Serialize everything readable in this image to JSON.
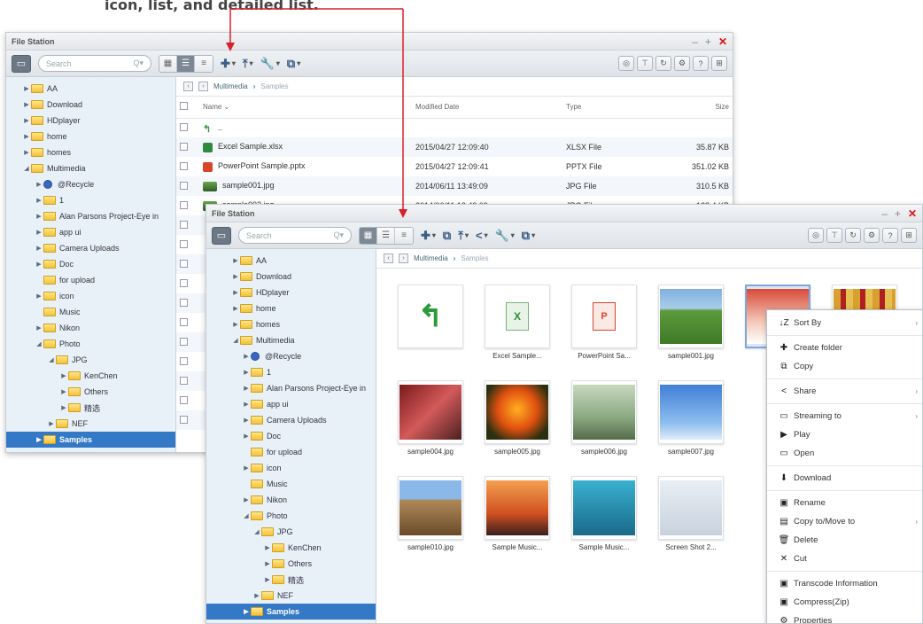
{
  "caption": "icon, list, and detailed list.",
  "colors": {
    "arrow": "#d9202a",
    "selection": "#3479c6",
    "sidebar_bg": "#e8f0f8"
  },
  "back_window": {
    "title": "File Station",
    "search_placeholder": "Search",
    "breadcrumb": [
      "Multimedia",
      "Samples"
    ],
    "tree": [
      {
        "label": "AA",
        "level": 1,
        "arrow": "▶",
        "icon": "folder-icon"
      },
      {
        "label": "Download",
        "level": 1,
        "arrow": "▶",
        "icon": "folder-icon"
      },
      {
        "label": "HDplayer",
        "level": 1,
        "arrow": "▶",
        "icon": "folder-icon"
      },
      {
        "label": "home",
        "level": 1,
        "arrow": "▶",
        "icon": "folder-icon"
      },
      {
        "label": "homes",
        "level": 1,
        "arrow": "▶",
        "icon": "folder-icon"
      },
      {
        "label": "Multimedia",
        "level": 1,
        "arrow": "◢",
        "icon": "folder-open-icon"
      },
      {
        "label": "@Recycle",
        "level": 2,
        "arrow": "▶",
        "icon": "recycle-icon"
      },
      {
        "label": "1",
        "level": 2,
        "arrow": "▶",
        "icon": "folder-icon"
      },
      {
        "label": "Alan Parsons Project-Eye in",
        "level": 2,
        "arrow": "▶",
        "icon": "folder-icon"
      },
      {
        "label": "app ui",
        "level": 2,
        "arrow": "▶",
        "icon": "folder-icon"
      },
      {
        "label": "Camera Uploads",
        "level": 2,
        "arrow": "▶",
        "icon": "folder-icon"
      },
      {
        "label": "Doc",
        "level": 2,
        "arrow": "▶",
        "icon": "folder-icon"
      },
      {
        "label": "for upload",
        "level": 2,
        "arrow": "",
        "icon": "folder-icon"
      },
      {
        "label": "icon",
        "level": 2,
        "arrow": "▶",
        "icon": "folder-icon"
      },
      {
        "label": "Music",
        "level": 2,
        "arrow": "",
        "icon": "folder-icon"
      },
      {
        "label": "Nikon",
        "level": 2,
        "arrow": "▶",
        "icon": "folder-icon"
      },
      {
        "label": "Photo",
        "level": 2,
        "arrow": "◢",
        "icon": "folder-open-icon"
      },
      {
        "label": "JPG",
        "level": 3,
        "arrow": "◢",
        "icon": "folder-open-icon"
      },
      {
        "label": "KenChen",
        "level": 4,
        "arrow": "▶",
        "icon": "folder-icon"
      },
      {
        "label": "Others",
        "level": 4,
        "arrow": "▶",
        "icon": "folder-icon"
      },
      {
        "label": "精选",
        "level": 4,
        "arrow": "▶",
        "icon": "folder-icon"
      },
      {
        "label": "NEF",
        "level": 3,
        "arrow": "▶",
        "icon": "folder-icon"
      },
      {
        "label": "Samples",
        "level": 2,
        "arrow": "▶",
        "icon": "folder-icon",
        "selected": true
      }
    ],
    "columns": [
      "Name ⌄",
      "Modified Date",
      "Type",
      "Size"
    ],
    "rows": [
      {
        "name": "..",
        "date": "",
        "type": "",
        "size": "",
        "icon": "up"
      },
      {
        "name": "Excel Sample.xlsx",
        "date": "2015/04/27 12:09:40",
        "type": "XLSX File",
        "size": "35.87 KB",
        "icon": "xls"
      },
      {
        "name": "PowerPoint Sample.pptx",
        "date": "2015/04/27 12:09:41",
        "type": "PPTX File",
        "size": "351.02 KB",
        "icon": "ppt"
      },
      {
        "name": "sample001.jpg",
        "date": "2014/06/11 13:49:09",
        "type": "JPG File",
        "size": "310.5 KB",
        "icon": "jpg"
      },
      {
        "name": "sample002.jpg",
        "date": "2014/06/11 13:49:09",
        "type": "JPG File",
        "size": "128.4 KB",
        "icon": "jpg"
      }
    ],
    "empty_rows": 11
  },
  "front_window": {
    "title": "File Station",
    "search_placeholder": "Search",
    "breadcrumb": [
      "Multimedia",
      "Samples"
    ],
    "tree": [
      {
        "label": "AA",
        "arrow": "▶"
      },
      {
        "label": "Download",
        "arrow": "▶"
      },
      {
        "label": "HDplayer",
        "arrow": "▶"
      },
      {
        "label": "home",
        "arrow": "▶"
      },
      {
        "label": "homes",
        "arrow": "▶"
      },
      {
        "label": "Multimedia",
        "arrow": "◢"
      },
      {
        "label": "@Recycle",
        "arrow": "▶",
        "icon": "recycle"
      },
      {
        "label": "1",
        "arrow": "▶"
      },
      {
        "label": "Alan Parsons Project-Eye in",
        "arrow": "▶"
      },
      {
        "label": "app ui",
        "arrow": "▶"
      },
      {
        "label": "Camera Uploads",
        "arrow": "▶"
      },
      {
        "label": "Doc",
        "arrow": "▶"
      },
      {
        "label": "for upload",
        "arrow": ""
      },
      {
        "label": "icon",
        "arrow": "▶"
      },
      {
        "label": "Music",
        "arrow": ""
      },
      {
        "label": "Nikon",
        "arrow": "▶"
      },
      {
        "label": "Photo",
        "arrow": "◢"
      },
      {
        "label": "JPG",
        "arrow": "◢"
      },
      {
        "label": "KenChen",
        "arrow": "▶"
      },
      {
        "label": "Others",
        "arrow": "▶"
      },
      {
        "label": "精选",
        "arrow": "▶"
      },
      {
        "label": "NEF",
        "arrow": "▶"
      },
      {
        "label": "Samples",
        "arrow": "▶",
        "selected": true
      }
    ],
    "tiles": [
      {
        "label": "",
        "kind": "up"
      },
      {
        "label": "Excel Sample...",
        "kind": "xls"
      },
      {
        "label": "PowerPoint Sa...",
        "kind": "ppt"
      },
      {
        "label": "sample001.jpg",
        "kind": "photo-green"
      },
      {
        "label": "",
        "kind": "photo-sel"
      },
      {
        "label": "",
        "kind": "photo-food"
      },
      {
        "label": "sample004.jpg",
        "kind": "photo-red"
      },
      {
        "label": "sample005.jpg",
        "kind": "photo-orange"
      },
      {
        "label": "sample006.jpg",
        "kind": "photo-grass"
      },
      {
        "label": "sample007.jpg",
        "kind": "photo-blue"
      },
      {
        "label": "sample010.jpg",
        "kind": "photo-brown"
      },
      {
        "label": "Sample Music...",
        "kind": "music-sunset"
      },
      {
        "label": "Sample Music...",
        "kind": "music-sea"
      },
      {
        "label": "Screen Shot 2...",
        "kind": "screenshot"
      }
    ],
    "context_menu": [
      {
        "label": "Sort By",
        "icon": "↓Z",
        "submenu": true
      },
      {
        "sep": true
      },
      {
        "label": "Create folder",
        "icon": "✚",
        "submenu": false
      },
      {
        "label": "Copy",
        "icon": "⧉",
        "submenu": false
      },
      {
        "sep": true
      },
      {
        "label": "Share",
        "icon": "<",
        "submenu": true
      },
      {
        "sep": true
      },
      {
        "label": "Streaming to",
        "icon": "▭",
        "submenu": true
      },
      {
        "label": "Play",
        "icon": "▶",
        "submenu": false
      },
      {
        "label": "Open",
        "icon": "▭",
        "submenu": false
      },
      {
        "sep": true
      },
      {
        "label": "Download",
        "icon": "⬇",
        "submenu": false
      },
      {
        "sep": true
      },
      {
        "label": "Rename",
        "icon": "▣",
        "submenu": false
      },
      {
        "label": "Copy to/Move to",
        "icon": "▤",
        "submenu": true
      },
      {
        "label": "Delete",
        "icon": "🗑",
        "submenu": false
      },
      {
        "label": "Cut",
        "icon": "✕",
        "submenu": false
      },
      {
        "sep": true
      },
      {
        "label": "Transcode Information",
        "icon": "▣",
        "submenu": false
      },
      {
        "label": "Compress(Zip)",
        "icon": "▣",
        "submenu": false
      },
      {
        "label": "Properties",
        "icon": "⚙",
        "submenu": false
      }
    ]
  }
}
